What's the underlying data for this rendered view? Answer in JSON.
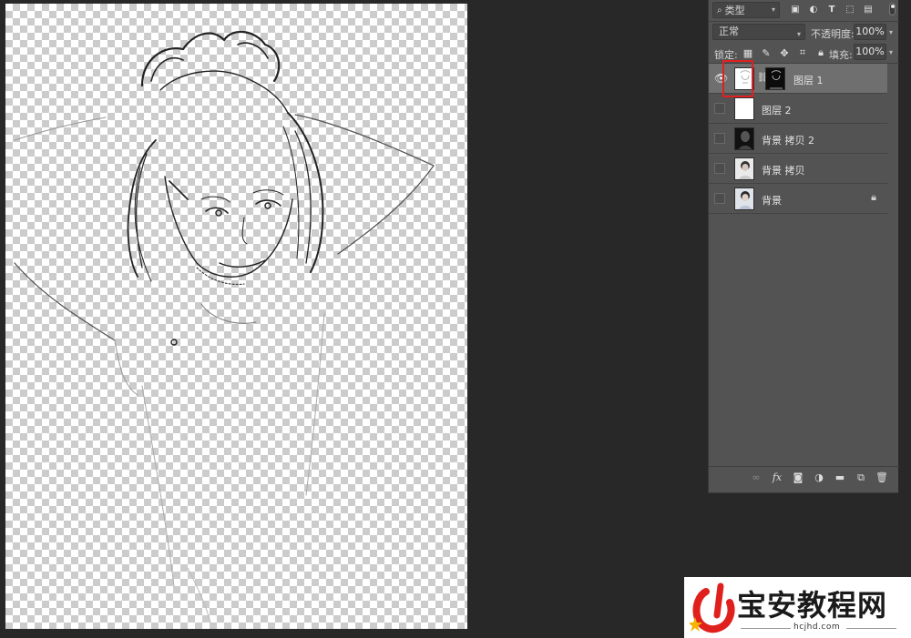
{
  "layers_panel": {
    "filter": {
      "icon": "search-icon",
      "label": "类型"
    },
    "filter_icons": [
      "image-filter-icon",
      "adjustment-filter-icon",
      "type-filter-icon",
      "shape-filter-icon",
      "smart-object-filter-icon"
    ],
    "blend_mode": "正常",
    "opacity_label": "不透明度:",
    "opacity_value": "100%",
    "lock_label": "锁定:",
    "lock_icons": [
      "lock-transparent-icon",
      "lock-brush-icon",
      "lock-move-icon",
      "lock-artboard-icon",
      "lock-all-icon"
    ],
    "fill_label": "填充:",
    "fill_value": "100%",
    "layers": [
      {
        "name": "图层 1",
        "visible": true,
        "selected": true,
        "has_mask": true,
        "thumb": "white",
        "locked": false
      },
      {
        "name": "图层 2",
        "visible": false,
        "selected": false,
        "has_mask": false,
        "thumb": "white",
        "locked": false
      },
      {
        "name": "背景 拷贝 2",
        "visible": false,
        "selected": false,
        "has_mask": false,
        "thumb": "dark",
        "locked": false
      },
      {
        "name": "背景 拷贝",
        "visible": false,
        "selected": false,
        "has_mask": false,
        "thumb": "light",
        "locked": false
      },
      {
        "name": "背景",
        "visible": false,
        "selected": false,
        "has_mask": false,
        "thumb": "photo",
        "locked": true
      }
    ],
    "bottom_icons": [
      "link-layers-icon",
      "fx-icon",
      "add-mask-icon",
      "adjustment-layer-icon",
      "new-group-icon",
      "new-layer-icon",
      "delete-icon"
    ]
  },
  "watermark": {
    "title": "宝安教程网",
    "url": "hcjhd.com",
    "colors": {
      "logo_red": "#e0201c",
      "logo_yellow": "#f5b400"
    }
  }
}
